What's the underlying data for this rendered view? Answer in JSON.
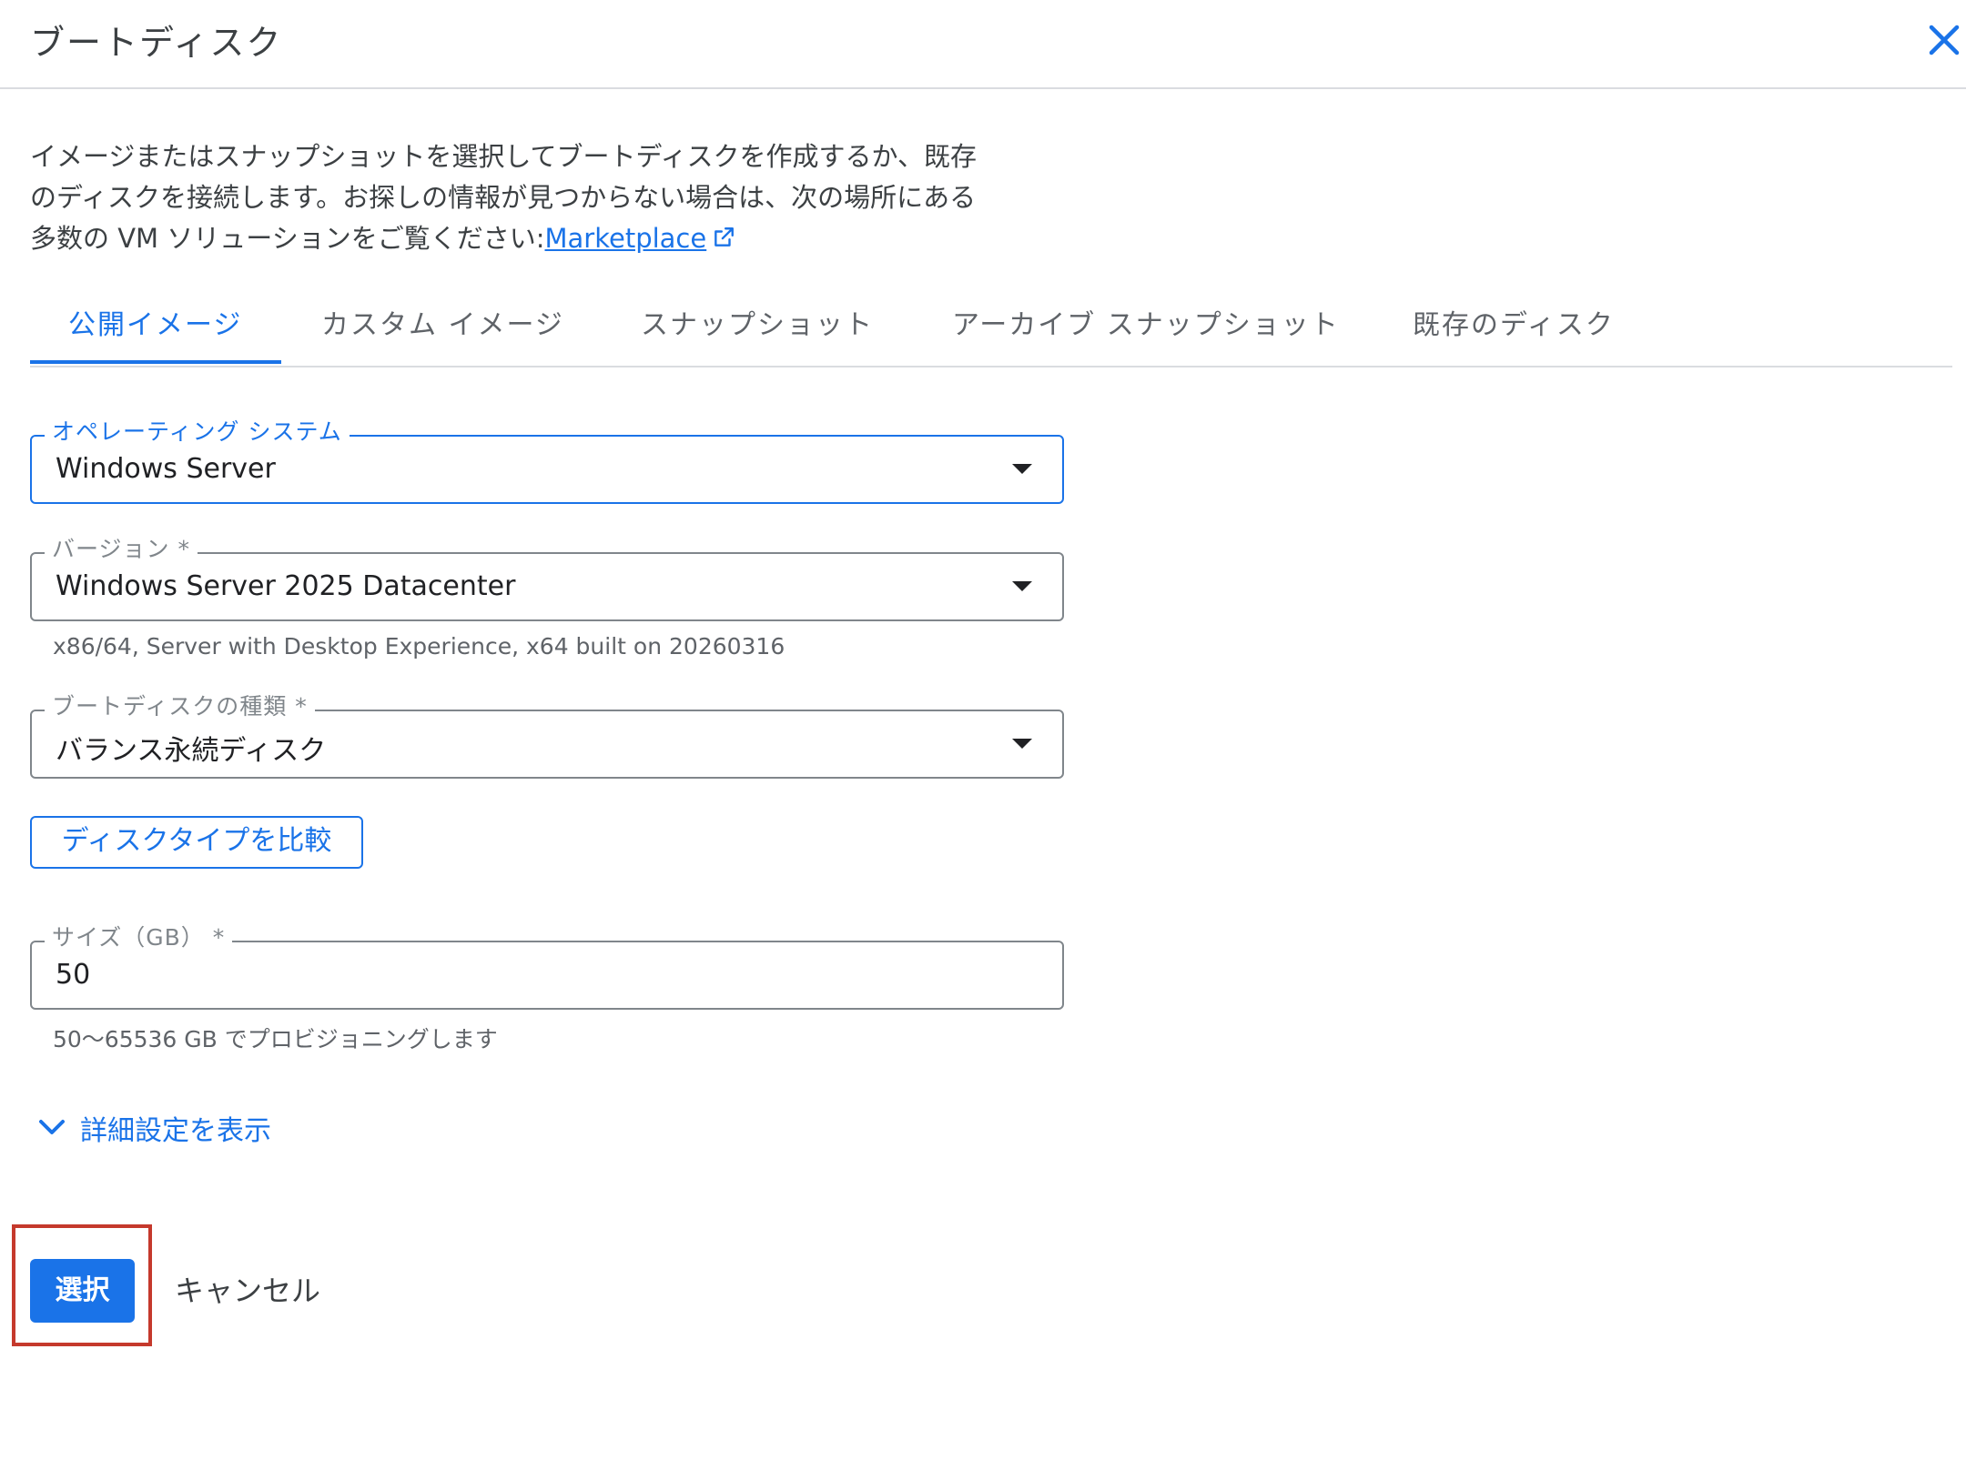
{
  "dialog": {
    "title": "ブートディスク",
    "close_icon": "close-icon"
  },
  "description": {
    "line1": "イメージまたはスナップショットを選択してブートディスクを作成するか、既存",
    "line2": "のディスクを接続します。お探しの情報が見つからない場合は、次の場所にある",
    "line3": "多数の VM ソリューションをご覧ください:",
    "link_text": "Marketplace",
    "link_icon": "open-in-new-icon"
  },
  "tabs": [
    {
      "label": "公開イメージ",
      "active": true
    },
    {
      "label": "カスタム イメージ",
      "active": false
    },
    {
      "label": "スナップショット",
      "active": false
    },
    {
      "label": "アーカイブ スナップショット",
      "active": false
    },
    {
      "label": "既存のディスク",
      "active": false
    }
  ],
  "fields": {
    "os": {
      "label": "オペレーティング システム",
      "value": "Windows Server"
    },
    "version": {
      "label": "バージョン *",
      "value": "Windows Server 2025 Datacenter",
      "hint": "x86/64, Server with Desktop Experience, x64 built on 20260316"
    },
    "disk_type": {
      "label": "ブートディスクの種類 *",
      "value": "バランス永続ディスク"
    },
    "size": {
      "label": "サイズ（GB） *",
      "value": "50",
      "hint": "50〜65536 GB でプロビジョニングします"
    }
  },
  "compare_button": "ディスクタイプを比較",
  "advanced_toggle": {
    "label": "詳細設定を表示",
    "icon": "chevron-down-icon"
  },
  "actions": {
    "select": "選択",
    "cancel": "キャンセル"
  },
  "colors": {
    "accent": "#1a73e8",
    "highlight": "#c5392c"
  }
}
